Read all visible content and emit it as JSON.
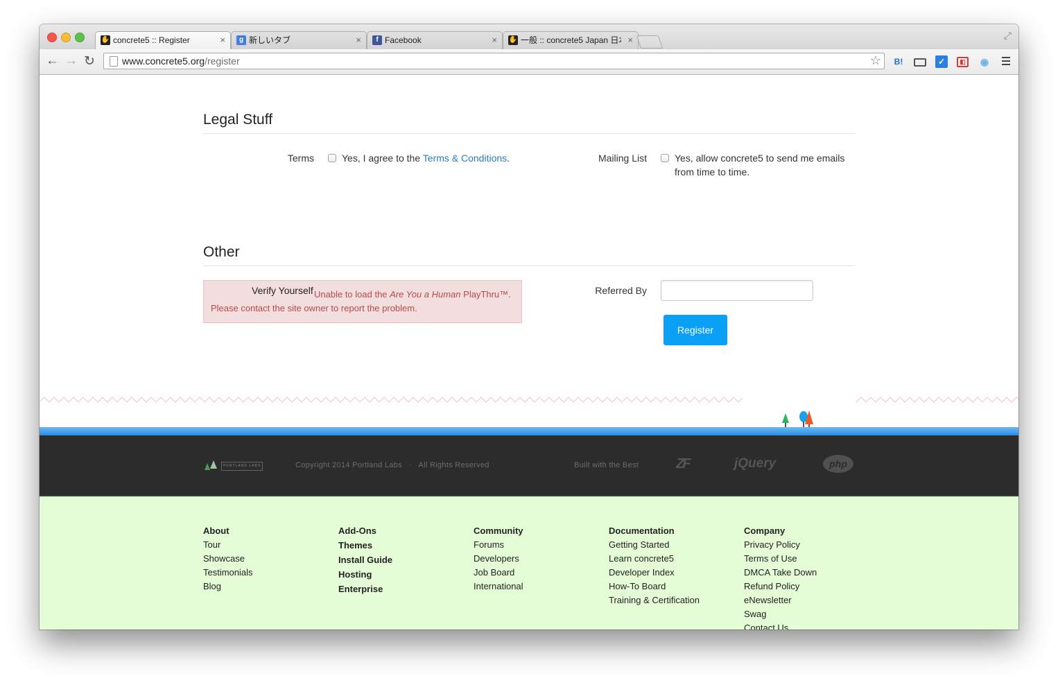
{
  "browser": {
    "tabs": [
      {
        "title": "concrete5 :: Register",
        "active": true,
        "favicon": "concrete5-hand-icon"
      },
      {
        "title": "新しいタブ",
        "active": false,
        "favicon": "google-icon"
      },
      {
        "title": "Facebook",
        "active": false,
        "favicon": "facebook-icon"
      },
      {
        "title": "一般 :: concrete5 Japan 日本",
        "active": false,
        "favicon": "concrete5-hand-icon"
      }
    ],
    "tab_close": "×",
    "url_host": "www.concrete5.org",
    "url_path": "/register",
    "extensions": [
      {
        "label": "B!",
        "color": "#1f6fd0"
      },
      {
        "label": "",
        "color": "#555555"
      },
      {
        "label": "",
        "color": "#2a7fe0"
      },
      {
        "label": "",
        "color": "#d83b34"
      },
      {
        "label": "",
        "color": "#6ab4e6"
      }
    ]
  },
  "legal": {
    "title": "Legal Stuff",
    "terms_label": "Terms",
    "terms_text": "Yes, I agree to the ",
    "terms_link": "Terms & Conditions",
    "terms_end": ".",
    "mailing_label": "Mailing List",
    "mailing_text_line1": "Yes, allow concrete5 to send me emails",
    "mailing_text_line2": "from time to time."
  },
  "other": {
    "title": "Other",
    "verify_label": "Verify Yourself",
    "error_line1_pre": "Unable to load the ",
    "error_line1_em": "Are You a Human",
    "error_line1_post": " PlayThru™.",
    "error_line2": "Please contact the site owner to report the problem.",
    "referred_label": "Referred By",
    "referred_value": "",
    "register_label": "Register"
  },
  "dark_footer": {
    "logo_text": "PORTLAND LABS",
    "copyright": "Copyright 2014 Portland Labs   ·   All Rights Reserved",
    "built_with": "Built with the Best",
    "zf_logo": "ZF",
    "jquery_logo": "jQuery",
    "php_logo": "php"
  },
  "footer_columns": [
    {
      "heading": "About",
      "items": [
        "Tour",
        "Showcase",
        "Testimonials",
        "Blog"
      ]
    },
    {
      "heading": "Add-Ons",
      "items": [
        "Themes",
        "Install Guide",
        "Hosting",
        "Enterprise"
      ]
    },
    {
      "heading": "Community",
      "items": [
        "Forums",
        "Developers",
        "Job Board",
        "International"
      ]
    },
    {
      "heading": "Documentation",
      "items": [
        "Getting Started",
        "Learn concrete5",
        "Developer Index",
        "How-To Board",
        "Training & Certification"
      ]
    },
    {
      "heading": "Company",
      "items": [
        "Privacy Policy",
        "Terms of Use",
        "DMCA Take Down",
        "Refund Policy",
        "eNewsletter",
        "Swag",
        "Contact Us"
      ]
    }
  ]
}
